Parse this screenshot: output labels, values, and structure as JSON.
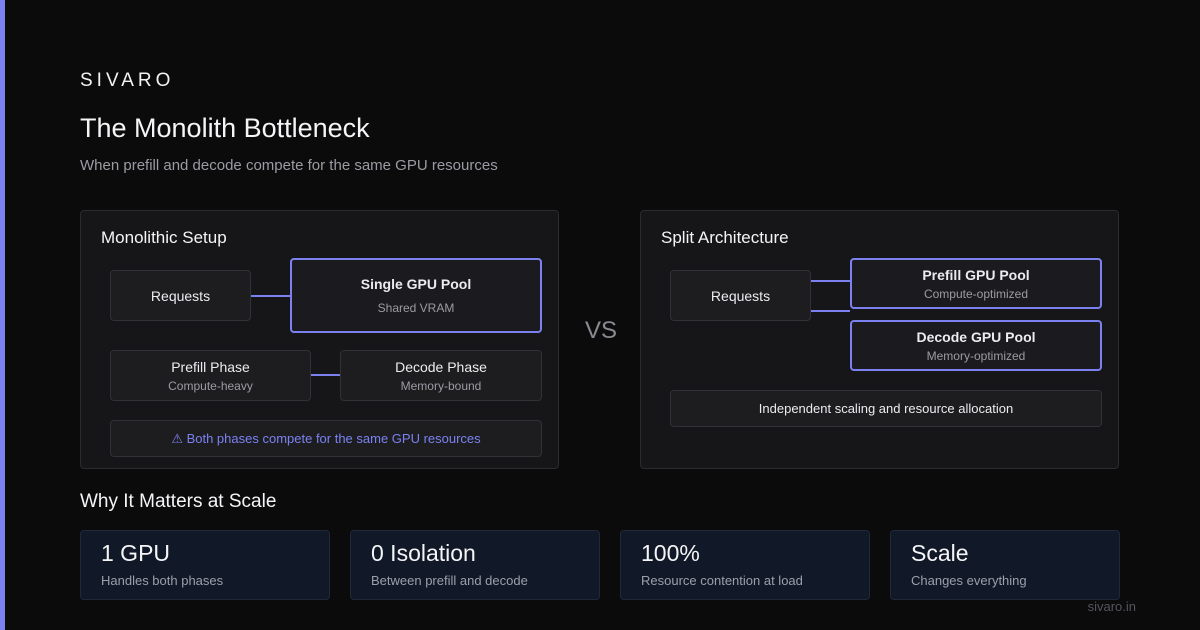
{
  "brand": "SIVARO",
  "title": "The Monolith Bottleneck",
  "subtitle": "When prefill and decode compete for the same GPU resources",
  "left_panel": {
    "title": "Monolithic Setup",
    "requests": "Requests",
    "pool_title": "Single GPU Pool",
    "pool_sub": "Shared VRAM",
    "prefill_title": "Prefill Phase",
    "prefill_sub": "Compute-heavy",
    "decode_title": "Decode Phase",
    "decode_sub": "Memory-bound",
    "warning": "⚠ Both phases compete for the same GPU resources"
  },
  "vs": "VS",
  "right_panel": {
    "title": "Split Architecture",
    "requests": "Requests",
    "prefill_pool_title": "Prefill GPU Pool",
    "prefill_pool_sub": "Compute-optimized",
    "decode_pool_title": "Decode GPU Pool",
    "decode_pool_sub": "Memory-optimized",
    "note": "Independent scaling and resource allocation"
  },
  "section_title": "Why It Matters at Scale",
  "stats": [
    {
      "value": "1 GPU",
      "label": "Handles both phases"
    },
    {
      "value": "0 Isolation",
      "label": "Between prefill and decode"
    },
    {
      "value": "100%",
      "label": "Resource contention at load"
    },
    {
      "value": "Scale",
      "label": "Changes everything"
    }
  ],
  "footer": "sivaro.in",
  "colors": {
    "accent": "#7b82f0",
    "background": "#0b0b0c",
    "panel": "#161618",
    "stat_card": "#111827"
  }
}
